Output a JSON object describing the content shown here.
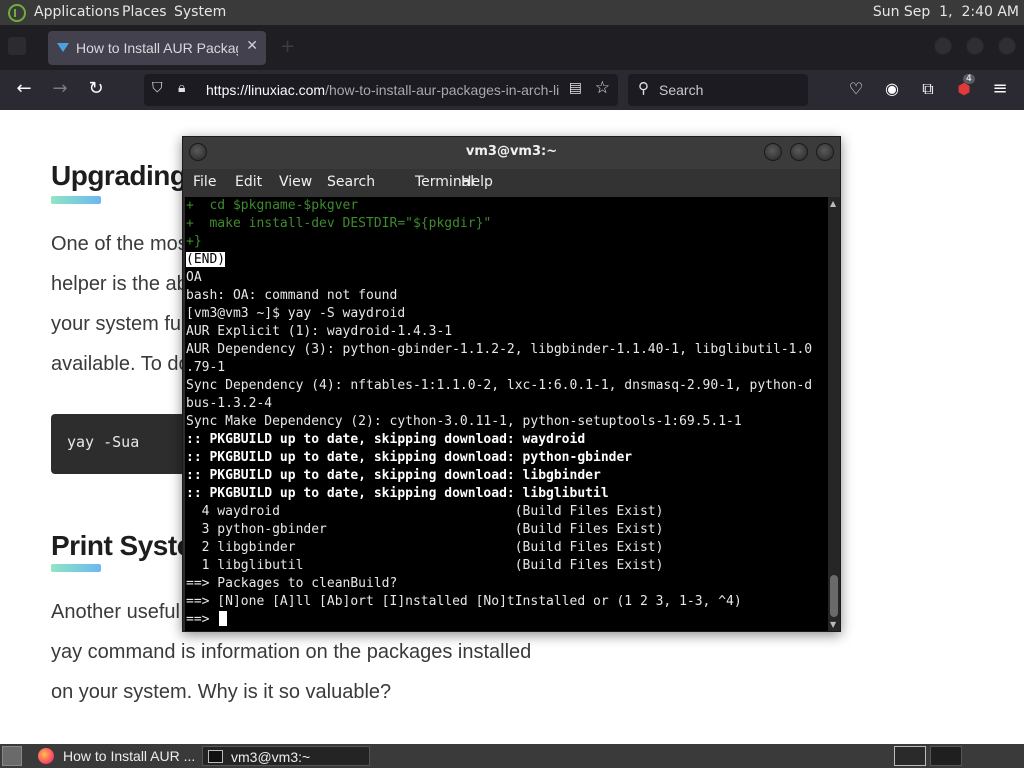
{
  "top_panel": {
    "menus": [
      "Applications",
      "Places",
      "System"
    ],
    "clock": "Sun Sep  1,  2:40 AM"
  },
  "browser": {
    "tab_title": "How to Install AUR Packages in Arch Linux",
    "url_host": "https://linuxiac.com",
    "url_path": "/how-to-install-aur-packages-in-arch-linux/",
    "search_placeholder": "Search",
    "extension_badge": "4"
  },
  "page": {
    "heading1": "Upgrading AUR Packages",
    "para1": [
      "One of the most important features of an AUR",
      "helper is the ability to keep AUR packages on",
      "your system fully updated whenever new versions are",
      "available. To do it, run the following:"
    ],
    "code": "yay -Sua",
    "heading2": "Print System Statistics",
    "para2": [
      "Another useful feature worth mentioning of the",
      "yay command is information on the packages installed",
      "on your system. Why is it so valuable?"
    ]
  },
  "terminal": {
    "title": "vm3@vm3:~",
    "menu": [
      "File",
      "Edit",
      "View",
      "Search",
      "Terminal",
      "Help"
    ],
    "lines": [
      {
        "text": "+  cd $pkgname-$pkgver",
        "style": "green"
      },
      {
        "text": "+  make install-dev DESTDIR=\"${pkgdir}\"",
        "style": "green"
      },
      {
        "text": "+}",
        "style": "green"
      },
      {
        "text": "(END)",
        "style": "inv"
      },
      {
        "text": "OA",
        "style": ""
      },
      {
        "text": "bash: OA: command not found",
        "style": ""
      },
      {
        "text": "[vm3@vm3 ~]$ yay -S waydroid",
        "style": ""
      },
      {
        "text": "AUR Explicit (1): waydroid-1.4.3-1",
        "style": ""
      },
      {
        "text": "AUR Dependency (3): python-gbinder-1.1.2-2, libgbinder-1.1.40-1, libglibutil-1.0",
        "style": ""
      },
      {
        "text": ".79-1",
        "style": ""
      },
      {
        "text": "Sync Dependency (4): nftables-1:1.1.0-2, lxc-1:6.0.1-1, dnsmasq-2.90-1, python-d",
        "style": ""
      },
      {
        "text": "bus-1.3.2-4",
        "style": ""
      },
      {
        "text": "Sync Make Dependency (2): cython-3.0.11-1, python-setuptools-1:69.5.1-1",
        "style": ""
      },
      {
        "text": ":: PKGBUILD up to date, skipping download: waydroid",
        "style": "bold"
      },
      {
        "text": ":: PKGBUILD up to date, skipping download: python-gbinder",
        "style": "bold"
      },
      {
        "text": ":: PKGBUILD up to date, skipping download: libgbinder",
        "style": "bold"
      },
      {
        "text": ":: PKGBUILD up to date, skipping download: libglibutil",
        "style": "bold"
      },
      {
        "text": "  4 waydroid                              (Build Files Exist)",
        "style": ""
      },
      {
        "text": "  3 python-gbinder                        (Build Files Exist)",
        "style": ""
      },
      {
        "text": "  2 libgbinder                            (Build Files Exist)",
        "style": ""
      },
      {
        "text": "  1 libglibutil                           (Build Files Exist)",
        "style": ""
      },
      {
        "text": "==> Packages to cleanBuild?",
        "style": ""
      },
      {
        "text": "==> [N]one [A]ll [Ab]ort [I]nstalled [No]tInstalled or (1 2 3, 1-3, ^4)",
        "style": ""
      },
      {
        "text": "==> ",
        "style": "prompt"
      }
    ]
  },
  "bottom_panel": {
    "tasks": [
      "How to Install AUR ...",
      "vm3@vm3:~"
    ]
  }
}
